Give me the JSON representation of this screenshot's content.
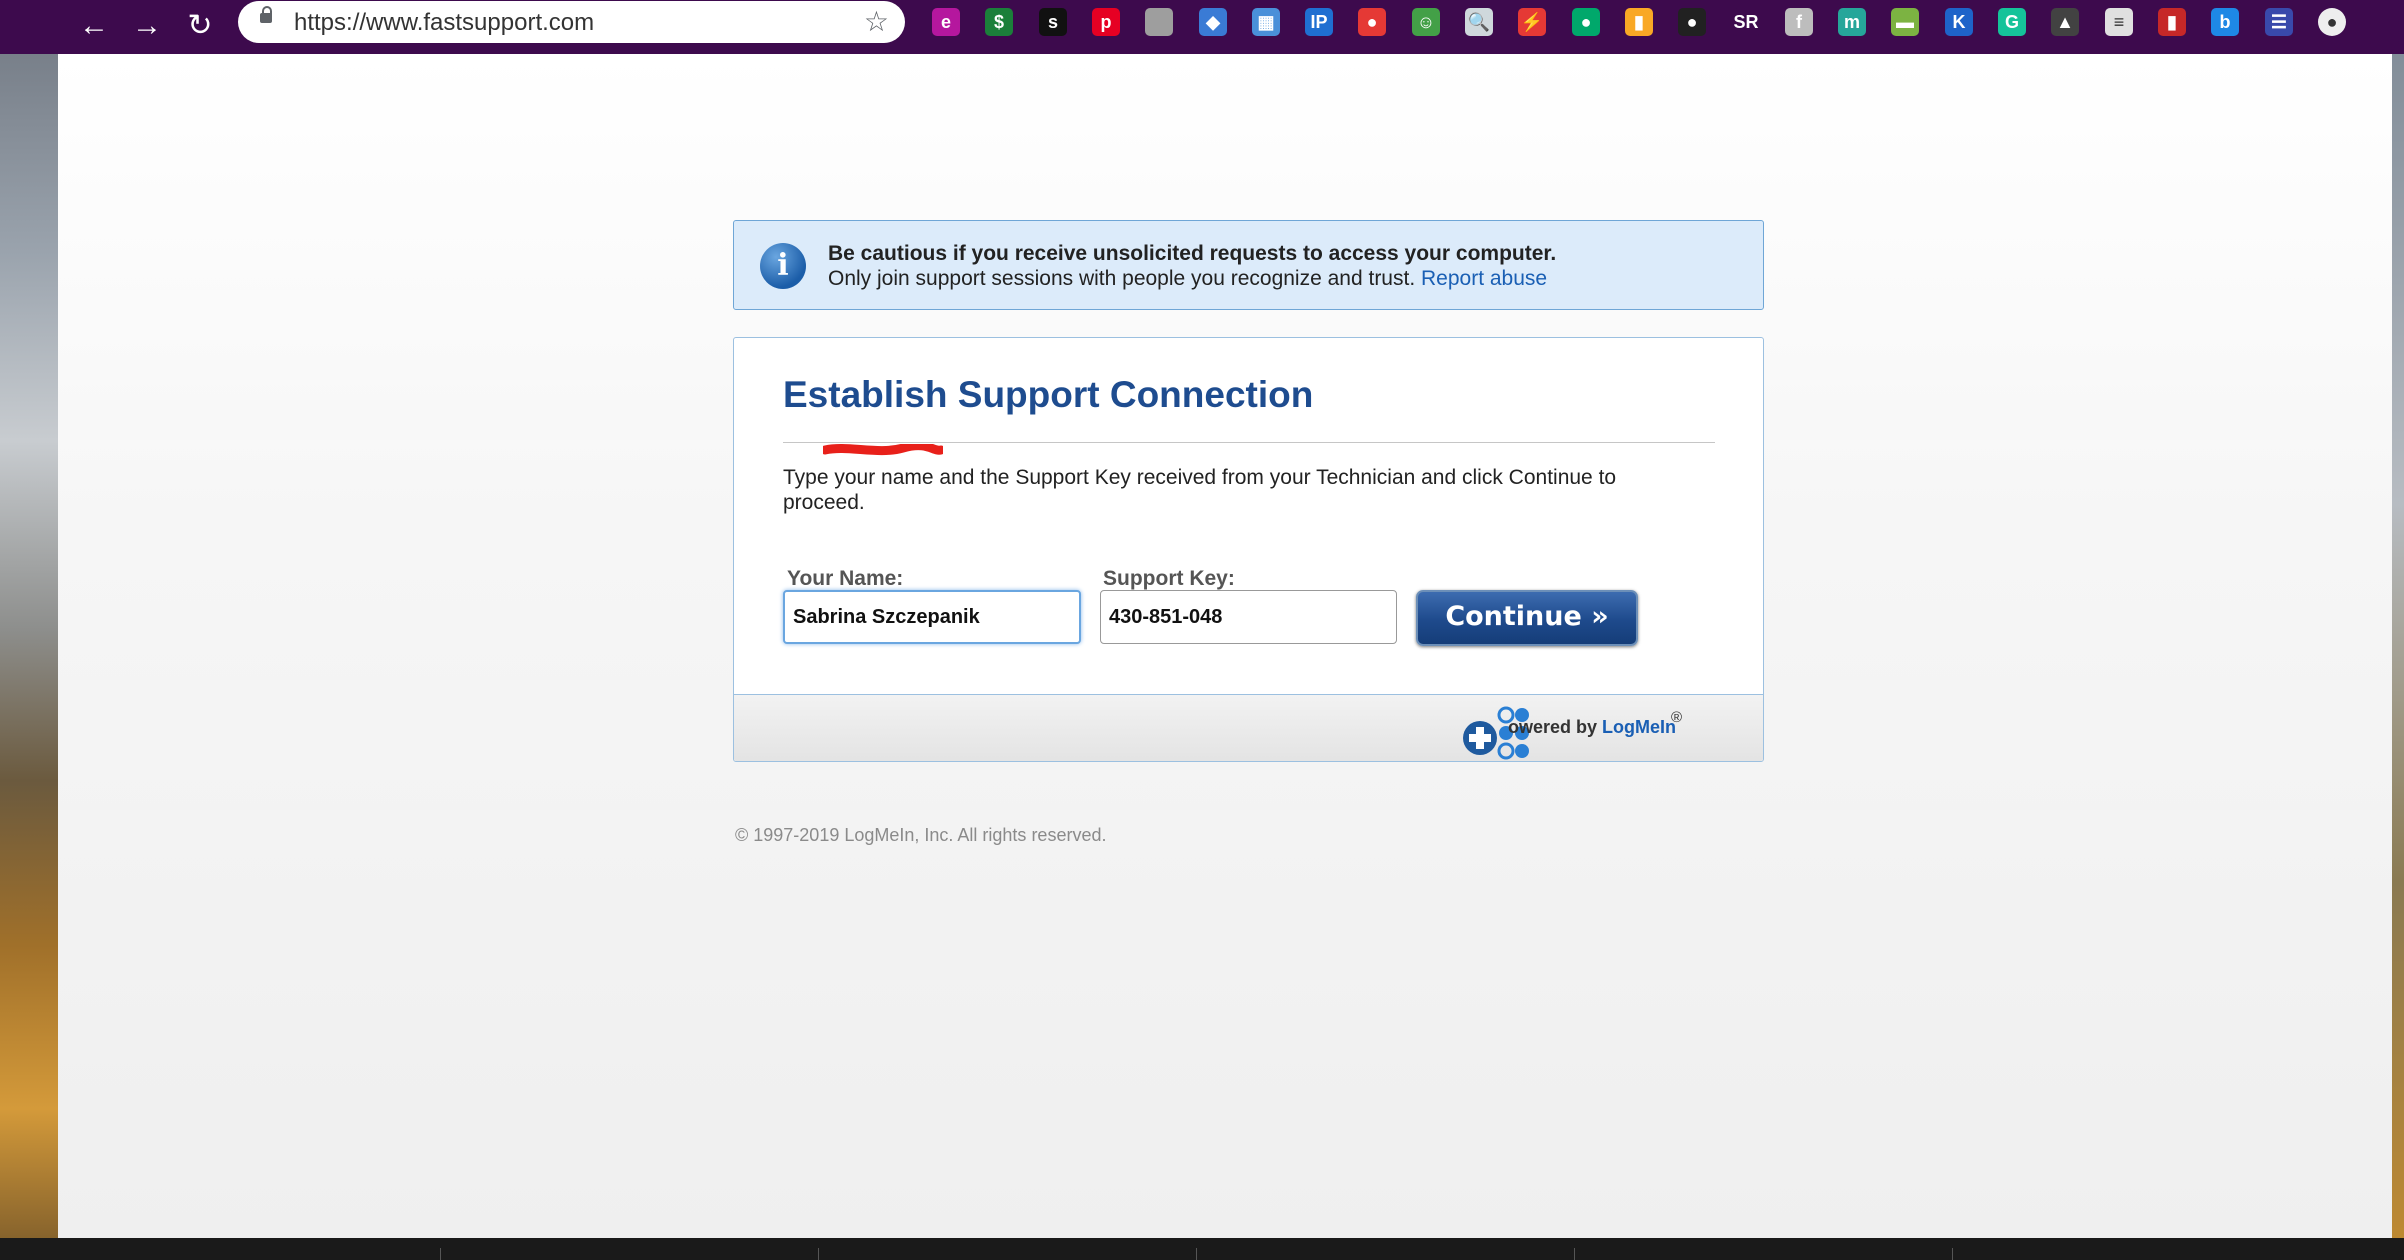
{
  "browser": {
    "url": "https://www.fastsupport.com",
    "extensions": [
      {
        "name": "e-extension-icon",
        "glyph": "e",
        "color": "#b5179e"
      },
      {
        "name": "dollar-extension-icon",
        "glyph": "$",
        "color": "#1b7f3a"
      },
      {
        "name": "s-extension-icon",
        "glyph": "s",
        "color": "#111111"
      },
      {
        "name": "pinterest-extension-icon",
        "glyph": "p",
        "color": "#e60023"
      },
      {
        "name": "grey-box-extension-icon",
        "glyph": "",
        "color": "#9e9e9e"
      },
      {
        "name": "diamond-extension-icon",
        "glyph": "◆",
        "color": "#3a7bd5"
      },
      {
        "name": "image-extension-icon",
        "glyph": "▦",
        "color": "#4a90d9"
      },
      {
        "name": "ip-extension-icon",
        "glyph": "IP",
        "color": "#1f6fd1"
      },
      {
        "name": "red-circle-extension-icon",
        "glyph": "●",
        "color": "#e53935"
      },
      {
        "name": "green-square-extension-icon",
        "glyph": "☺",
        "color": "#43a047"
      },
      {
        "name": "search-extension-icon",
        "glyph": "🔍",
        "color": "#cfd8dc"
      },
      {
        "name": "bolt-extension-icon",
        "glyph": "⚡",
        "color": "#e53935"
      },
      {
        "name": "cart-extension-icon",
        "glyph": "●",
        "color": "#00a86b"
      },
      {
        "name": "bag-extension-icon",
        "glyph": "▮",
        "color": "#f9a825"
      },
      {
        "name": "ghost-extension-icon",
        "glyph": "●",
        "color": "#212121"
      },
      {
        "name": "sr-extension-icon",
        "glyph": "SR",
        "color": "#3d0a4d"
      },
      {
        "name": "f-extension-icon",
        "glyph": "f",
        "color": "#bdbdbd"
      },
      {
        "name": "m-extension-icon",
        "glyph": "m",
        "color": "#26a69a"
      },
      {
        "name": "money-extension-icon",
        "glyph": "▬",
        "color": "#7cb342"
      },
      {
        "name": "k-extension-icon",
        "glyph": "K",
        "color": "#1e63c9"
      },
      {
        "name": "grammarly-extension-icon",
        "glyph": "G",
        "color": "#15c39a"
      },
      {
        "name": "hat-extension-icon",
        "glyph": "▲",
        "color": "#424242"
      },
      {
        "name": "newspaper-extension-icon",
        "glyph": "≡",
        "color": "#e0e0e0"
      },
      {
        "name": "book-extension-icon",
        "glyph": "▮",
        "color": "#c62828"
      },
      {
        "name": "b-extension-icon",
        "glyph": "b",
        "color": "#1e88e5"
      },
      {
        "name": "list-extension-icon",
        "glyph": "☰",
        "color": "#3949ab"
      },
      {
        "name": "profile-avatar-icon",
        "glyph": "●",
        "color": "#eeeeee"
      }
    ]
  },
  "notice": {
    "bold": "Be cautious if you receive unsolicited requests to access your computer.",
    "text": "Only join support sessions with people you recognize and trust.",
    "link": "Report abuse"
  },
  "card": {
    "title": "Establish Support Connection",
    "instructions": "Type your name and the Support Key received from your Technician and click Continue to proceed.",
    "name_label": "Your Name:",
    "name_value": "Sabrina Szczepanik",
    "key_label": "Support Key:",
    "key_value": "430-851-048",
    "continue_label": "Continue »"
  },
  "footer": {
    "powered_prefix": "owered by ",
    "powered_brand": "LogMeIn",
    "registered": "®",
    "copyright": "© 1997-2019 LogMeIn, Inc. All rights reserved."
  },
  "colors": {
    "chrome_bg": "#3d0a4d",
    "title_blue": "#1e4c8f",
    "link_blue": "#1a5fb4",
    "notice_bg": "#dcebfa",
    "redaction_red": "#e8201a"
  }
}
